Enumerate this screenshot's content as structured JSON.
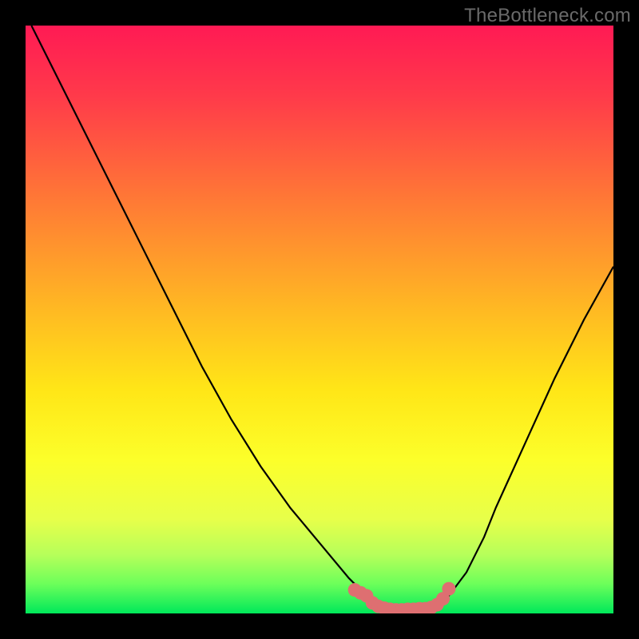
{
  "watermark": "TheBottleneck.com",
  "colors": {
    "frame": "#000000",
    "curve": "#000000",
    "marker": "#de6f71",
    "green": "#00e85a"
  },
  "chart_data": {
    "type": "line",
    "title": "",
    "xlabel": "",
    "ylabel": "",
    "xlim": [
      0,
      100
    ],
    "ylim": [
      0,
      100
    ],
    "grid": false,
    "legend": false,
    "series": [
      {
        "name": "bottleneck-curve",
        "x": [
          1,
          5,
          10,
          15,
          20,
          25,
          30,
          35,
          40,
          45,
          50,
          55,
          58,
          60,
          62,
          65,
          68,
          70,
          72,
          75,
          78,
          80,
          85,
          90,
          95,
          100
        ],
        "y": [
          100,
          92,
          82,
          72,
          62,
          52,
          42,
          33,
          25,
          18,
          12,
          6,
          3,
          1,
          0.5,
          0.3,
          0.4,
          1,
          3,
          7,
          13,
          18,
          29,
          40,
          50,
          59
        ]
      }
    ],
    "markers": {
      "name": "sweet-spot-band",
      "x": [
        56,
        57,
        58,
        59,
        60,
        61,
        62,
        63,
        64,
        65,
        66,
        67,
        68,
        69,
        70,
        71,
        72
      ],
      "y": [
        4.0,
        3.5,
        3.0,
        1.8,
        1.2,
        0.9,
        0.7,
        0.6,
        0.6,
        0.7,
        0.7,
        0.8,
        0.8,
        1.0,
        1.5,
        2.5,
        4.2
      ]
    },
    "gradient_stops": [
      {
        "offset": 0.0,
        "color": "#ff1a54"
      },
      {
        "offset": 0.12,
        "color": "#ff3a4a"
      },
      {
        "offset": 0.3,
        "color": "#ff7a35"
      },
      {
        "offset": 0.48,
        "color": "#ffb823"
      },
      {
        "offset": 0.62,
        "color": "#ffe617"
      },
      {
        "offset": 0.74,
        "color": "#fcff2a"
      },
      {
        "offset": 0.84,
        "color": "#e7ff4a"
      },
      {
        "offset": 0.9,
        "color": "#b6ff5a"
      },
      {
        "offset": 0.95,
        "color": "#6cff5a"
      },
      {
        "offset": 1.0,
        "color": "#00e85a"
      }
    ]
  }
}
